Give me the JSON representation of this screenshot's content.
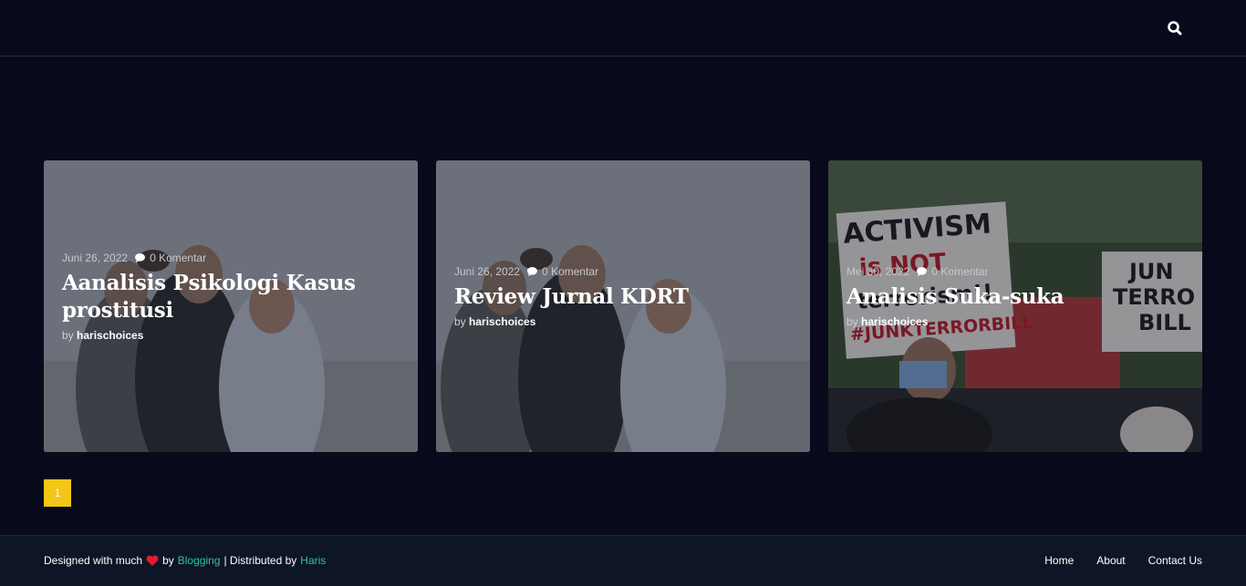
{
  "header": {
    "search_icon": "search-icon"
  },
  "posts": [
    {
      "date": "Juni 26, 2022",
      "comments": "0 Komentar",
      "title": "Aanalisis Psikologi Kasus prostitusi",
      "by": "by",
      "author": "harischoices",
      "image": "friends-laughing-photo"
    },
    {
      "date": "Juni 26, 2022",
      "comments": "0 Komentar",
      "title": "Review Jurnal KDRT",
      "by": "by",
      "author": "harischoices",
      "image": "friends-laughing-photo"
    },
    {
      "date": "Mei 30, 2022",
      "comments": "0 Komentar",
      "title": "Analisis Suka-suka",
      "by": "by",
      "author": "harischoices",
      "image": "protest-signs-photo",
      "sign_texts": [
        "ACTIVISM",
        "is NOT",
        "terrorism!!",
        "#JUNKTERRORBILL",
        "JUN",
        "TERRO",
        "BILL"
      ]
    }
  ],
  "pagination": {
    "current": "1"
  },
  "footer": {
    "designed_with": "Designed with much",
    "by": "by",
    "blogging": "Blogging",
    "distributed": "| Distributed by",
    "haris": "Haris",
    "nav": {
      "home": "Home",
      "about": "About",
      "contact": "Contact Us"
    }
  },
  "colors": {
    "background": "#080a1c",
    "accent": "#f5c518",
    "link": "#2ec4a5",
    "heart": "#e8192c"
  }
}
